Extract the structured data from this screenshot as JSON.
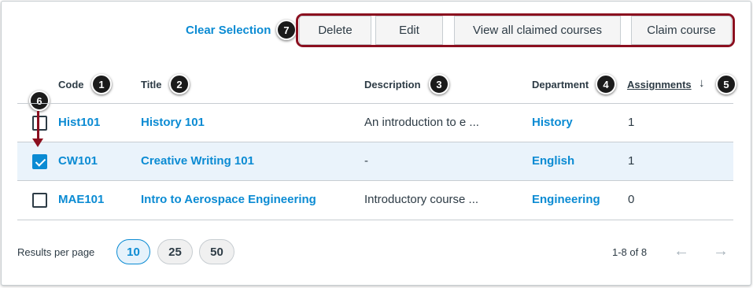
{
  "toolbar": {
    "clear_selection": "Clear Selection",
    "buttons": [
      "Delete",
      "Edit",
      "View all claimed courses",
      "Claim course"
    ]
  },
  "callouts": [
    "1",
    "2",
    "3",
    "4",
    "5",
    "6",
    "7"
  ],
  "columns": {
    "code": "Code",
    "title": "Title",
    "description": "Description",
    "department": "Department",
    "assignments": "Assignments"
  },
  "sort_icon": "arrow-down-icon",
  "rows": [
    {
      "checked": false,
      "code": "Hist101",
      "title": "History 101",
      "description": "An introduction to e ...",
      "department": "History",
      "assignments": "1"
    },
    {
      "checked": true,
      "code": "CW101",
      "title": "Creative Writing 101",
      "description": "-",
      "department": "English",
      "assignments": "1"
    },
    {
      "checked": false,
      "code": "MAE101",
      "title": "Intro to Aerospace Engineering",
      "description": "Introductory course ...",
      "department": "Engineering",
      "assignments": "0"
    }
  ],
  "footer": {
    "results_per_page_label": "Results per page",
    "page_sizes": [
      "10",
      "25",
      "50"
    ],
    "active_page_size": "10",
    "range": "1-8 of 8",
    "prev_icon": "←",
    "next_icon": "→"
  },
  "colors": {
    "accent": "#0b8bd3",
    "callout_outline": "#8b0f1f",
    "selected_row": "#eaf3fb"
  }
}
